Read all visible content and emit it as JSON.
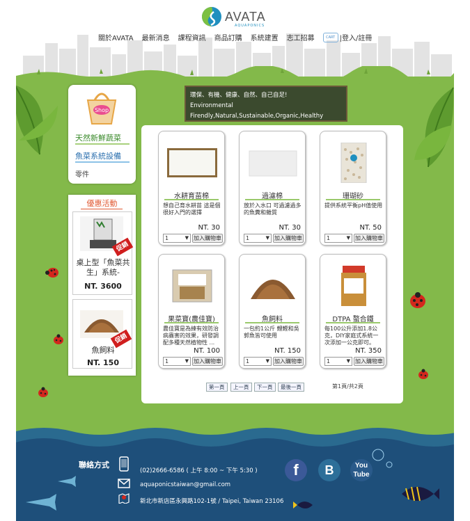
{
  "brand": {
    "logo_word": "AVATA",
    "logo_sub": "AQUAPONICS",
    "colors": {
      "green": "#83b94a",
      "blue": "#1f8fbf",
      "sea": "#1e4f7a",
      "red": "#d01e1e"
    }
  },
  "nav": {
    "items": [
      "關於AVATA",
      "最新消息",
      "課程資訊",
      "商品訂購",
      "系統建置",
      "志工招募"
    ],
    "cart_label": "CART",
    "login_label": "|登入/註冊"
  },
  "sidebar": {
    "shop_label": "Shop",
    "categories": [
      "天然新鮮蔬菜",
      "魚菜系統設備",
      "零件"
    ],
    "promo_title": "優惠活動",
    "promos": [
      {
        "name": "桌上型「魚菜共生」系統-",
        "price": "NT. 3600",
        "tag": "促銷"
      },
      {
        "name": "魚飼料",
        "price": "NT. 150",
        "tag": "促銷"
      }
    ]
  },
  "banner": {
    "line1": "環保、有機、健康、自然、自己自足!",
    "line2": "Environmental",
    "line3": "Firendly,Natural,Sustainable,Organic,Healthy"
  },
  "products": [
    {
      "name": "水耕育苗棉",
      "desc": "想自己育水耕苗 這是個很好入門的選擇",
      "price": "NT. 30",
      "qty": "1",
      "button": "加入購物車"
    },
    {
      "name": "過濾棉",
      "desc": "放於入水口 可過濾過多的魚糞和雜質",
      "price": "NT. 30",
      "qty": "1",
      "button": "加入購物車"
    },
    {
      "name": "珊瑚砂",
      "desc": "提供系統平衡pH值使用",
      "price": "NT. 50",
      "qty": "1",
      "button": "加入購物車"
    },
    {
      "name": "果菜寶(農佳寶)",
      "desc": "農佳寶是為練有效防治病蟲害的效果，研發調配多種天然植物性 ...",
      "price": "NT. 100",
      "qty": "1",
      "button": "加入購物車"
    },
    {
      "name": "魚飼料",
      "desc": "一包約1公斤 鯉鰹和吳郭魚皆可使用",
      "price": "NT. 150",
      "qty": "1",
      "button": "加入購物車"
    },
    {
      "name": "DTPA 螯合鐵",
      "desc": "每100公升添加1.8公克，DIY家庭式系統一次添加一公克即可。",
      "price": "NT. 350",
      "qty": "1",
      "button": "加入購物車"
    }
  ],
  "pager": {
    "first": "第一頁",
    "prev": "上一頁",
    "next": "下一頁",
    "last": "最後一頁",
    "info": "第1頁/共2頁"
  },
  "footer": {
    "title": "聯絡方式",
    "phone": "(02)2666-6586 ( 上午 8:00 ~ 下午 5:30 )",
    "email": "aquaponicstaiwan@gmail.com",
    "address": "新北市新店區永興路102-1號 / Taipei, Taiwan 23106",
    "social": [
      "facebook-icon",
      "blogger-icon",
      "youtube-icon"
    ],
    "youtube_top": "You",
    "youtube_bottom": "Tube"
  }
}
